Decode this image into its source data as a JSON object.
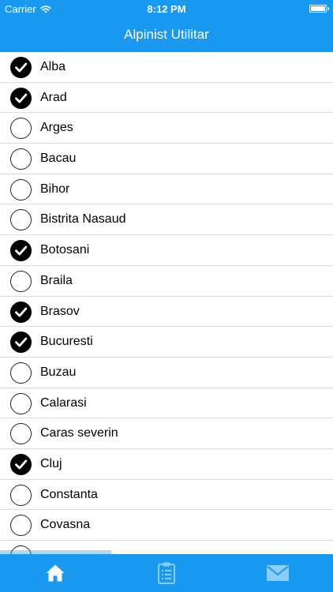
{
  "status_bar": {
    "carrier": "Carrier",
    "time": "8:12 PM",
    "wifi_icon": "wifi-icon",
    "battery_icon": "battery-icon"
  },
  "header": {
    "title": "Alpinist Utilitar"
  },
  "colors": {
    "accent": "#1a99f0",
    "checked": "#000000",
    "separator": "#dcdcdc"
  },
  "list": {
    "items": [
      {
        "label": "Alba",
        "checked": true
      },
      {
        "label": "Arad",
        "checked": true
      },
      {
        "label": "Arges",
        "checked": false
      },
      {
        "label": "Bacau",
        "checked": false
      },
      {
        "label": "Bihor",
        "checked": false
      },
      {
        "label": "Bistrita Nasaud",
        "checked": false
      },
      {
        "label": "Botosani",
        "checked": true
      },
      {
        "label": "Braila",
        "checked": false
      },
      {
        "label": "Brasov",
        "checked": true
      },
      {
        "label": "Bucuresti",
        "checked": true
      },
      {
        "label": "Buzau",
        "checked": false
      },
      {
        "label": "Calarasi",
        "checked": false
      },
      {
        "label": "Caras severin",
        "checked": false
      },
      {
        "label": "Cluj",
        "checked": true
      },
      {
        "label": "Constanta",
        "checked": false
      },
      {
        "label": "Covasna",
        "checked": false
      },
      {
        "label": "",
        "checked": false
      }
    ]
  },
  "tabbar": {
    "tabs": [
      {
        "icon": "home-icon",
        "active": true
      },
      {
        "icon": "clipboard-icon",
        "active": false
      },
      {
        "icon": "mail-icon",
        "active": false
      }
    ]
  }
}
